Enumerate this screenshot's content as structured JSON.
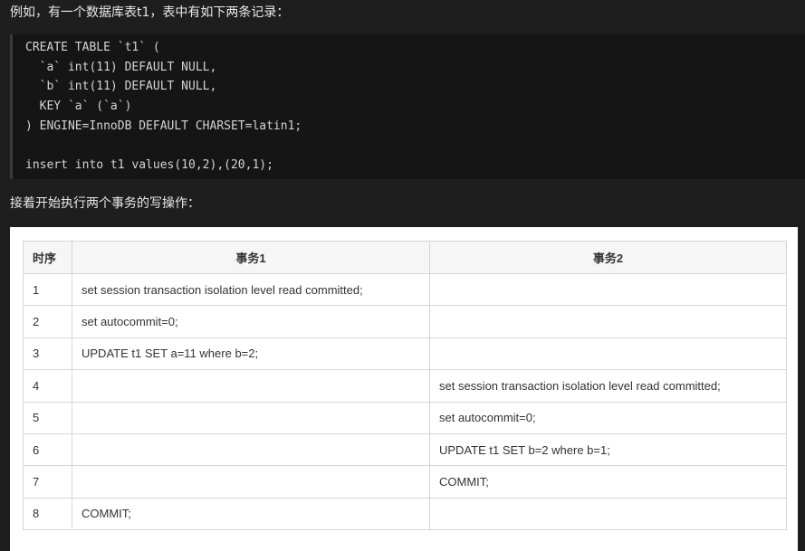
{
  "intro_text": "例如，有一个数据库表t1，表中有如下两条记录：",
  "code_lines": [
    "CREATE TABLE `t1` (",
    "  `a` int(11) DEFAULT NULL,",
    "  `b` int(11) DEFAULT NULL,",
    "  KEY `a` (`a`)",
    ") ENGINE=InnoDB DEFAULT CHARSET=latin1;",
    "",
    "insert into t1 values(10,2),(20,1);"
  ],
  "transition_text": "接着开始执行两个事务的写操作：",
  "table": {
    "headers": [
      "时序",
      "事务1",
      "事务2"
    ],
    "rows": [
      [
        "1",
        "set session transaction isolation level read committed;",
        ""
      ],
      [
        "2",
        "set autocommit=0;",
        ""
      ],
      [
        "3",
        "UPDATE t1 SET a=11 where b=2;",
        ""
      ],
      [
        "4",
        "",
        "set session transaction isolation level read committed;"
      ],
      [
        "5",
        "",
        "set autocommit=0;"
      ],
      [
        "6",
        "",
        "UPDATE t1 SET b=2 where b=1;"
      ],
      [
        "7",
        "",
        "COMMIT;"
      ],
      [
        "8",
        "COMMIT;",
        ""
      ]
    ]
  },
  "colors": {
    "page_background": "#1e1e1e",
    "code_background": "#151515",
    "table_background": "#ffffff",
    "table_header_background": "#f6f6f6",
    "table_border": "#d6d6d6"
  }
}
